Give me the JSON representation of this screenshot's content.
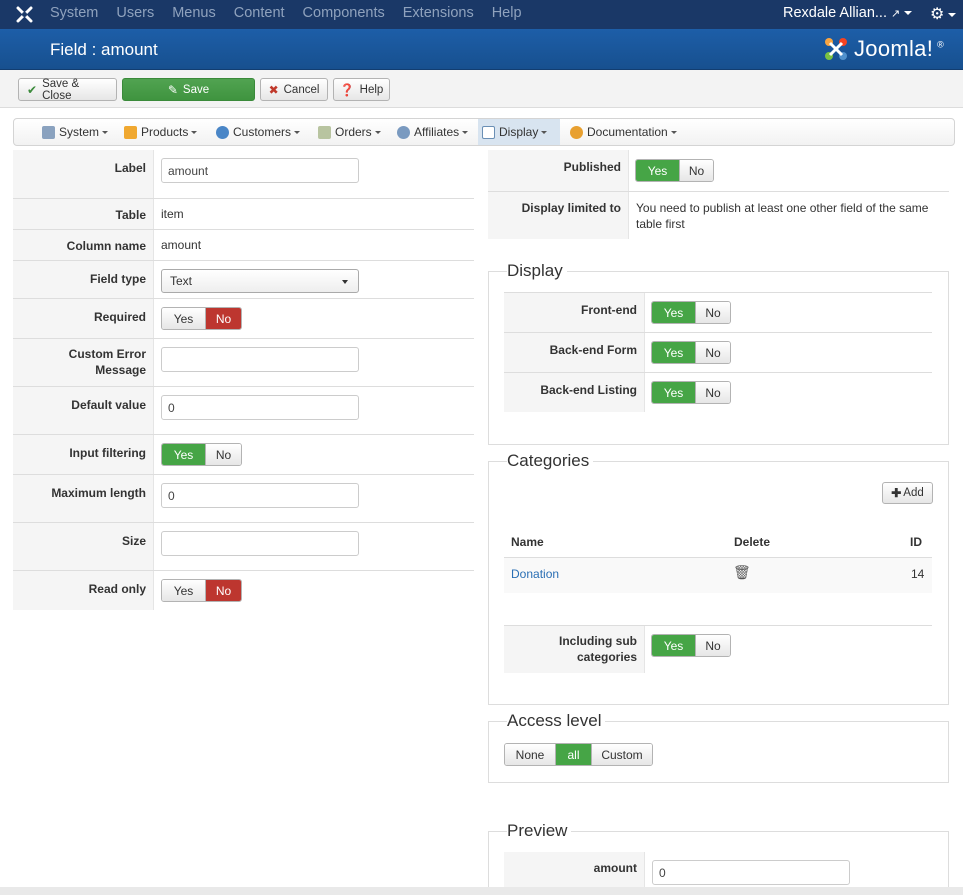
{
  "navbar": {
    "menu": [
      "System",
      "Users",
      "Menus",
      "Content",
      "Components",
      "Extensions",
      "Help"
    ],
    "user": "Rexdale Allian..."
  },
  "header": {
    "title": "Field : amount",
    "brand": "Joomla!"
  },
  "toolbar": {
    "save_close": "Save & Close",
    "save": "Save",
    "cancel": "Cancel",
    "help": "Help"
  },
  "component_menu": {
    "items": [
      "System",
      "Products",
      "Customers",
      "Orders",
      "Affiliates",
      "Display",
      "Documentation"
    ],
    "active": "Display"
  },
  "form": {
    "label": {
      "label": "Label",
      "value": "amount"
    },
    "table": {
      "label": "Table",
      "value": "item"
    },
    "column_name": {
      "label": "Column name",
      "value": "amount"
    },
    "field_type": {
      "label": "Field type",
      "value": "Text"
    },
    "required": {
      "label": "Required",
      "yes": "Yes",
      "no": "No",
      "selected": "No"
    },
    "custom_error": {
      "label_line1": "Custom Error",
      "label_line2": "Message",
      "value": ""
    },
    "default_value": {
      "label": "Default value",
      "value": "0"
    },
    "input_filtering": {
      "label": "Input filtering",
      "yes": "Yes",
      "no": "No",
      "selected": "Yes"
    },
    "maximum_length": {
      "label": "Maximum length",
      "value": "0"
    },
    "size": {
      "label": "Size",
      "value": ""
    },
    "read_only": {
      "label": "Read only",
      "yes": "Yes",
      "no": "No",
      "selected": "No"
    }
  },
  "right": {
    "published": {
      "label": "Published",
      "yes": "Yes",
      "no": "No",
      "selected": "Yes"
    },
    "display_limited": {
      "label": "Display limited to",
      "value": "You need to publish at least one other field of the same table first"
    },
    "display": {
      "legend": "Display",
      "front_end": {
        "label": "Front-end",
        "yes": "Yes",
        "no": "No",
        "selected": "Yes"
      },
      "back_end_form": {
        "label": "Back-end Form",
        "yes": "Yes",
        "no": "No",
        "selected": "Yes"
      },
      "back_end_listing": {
        "label": "Back-end Listing",
        "yes": "Yes",
        "no": "No",
        "selected": "Yes"
      }
    },
    "categories": {
      "legend": "Categories",
      "add_button": "Add",
      "columns": [
        "Name",
        "Delete",
        "ID"
      ],
      "rows": [
        {
          "name": "Donation",
          "id": "14"
        }
      ],
      "including_sub": {
        "label_line1": "Including sub",
        "label_line2": "categories",
        "yes": "Yes",
        "no": "No",
        "selected": "Yes"
      }
    },
    "access_level": {
      "legend": "Access level",
      "options": [
        "None",
        "all",
        "Custom"
      ],
      "selected": "all"
    },
    "preview": {
      "legend": "Preview",
      "label": "amount",
      "value": "0"
    }
  },
  "colors": {
    "navbar": "#1a3867",
    "header": "#1d5ea8",
    "green": "#46a546",
    "red": "#bd362f",
    "link": "#2a6fb4"
  }
}
